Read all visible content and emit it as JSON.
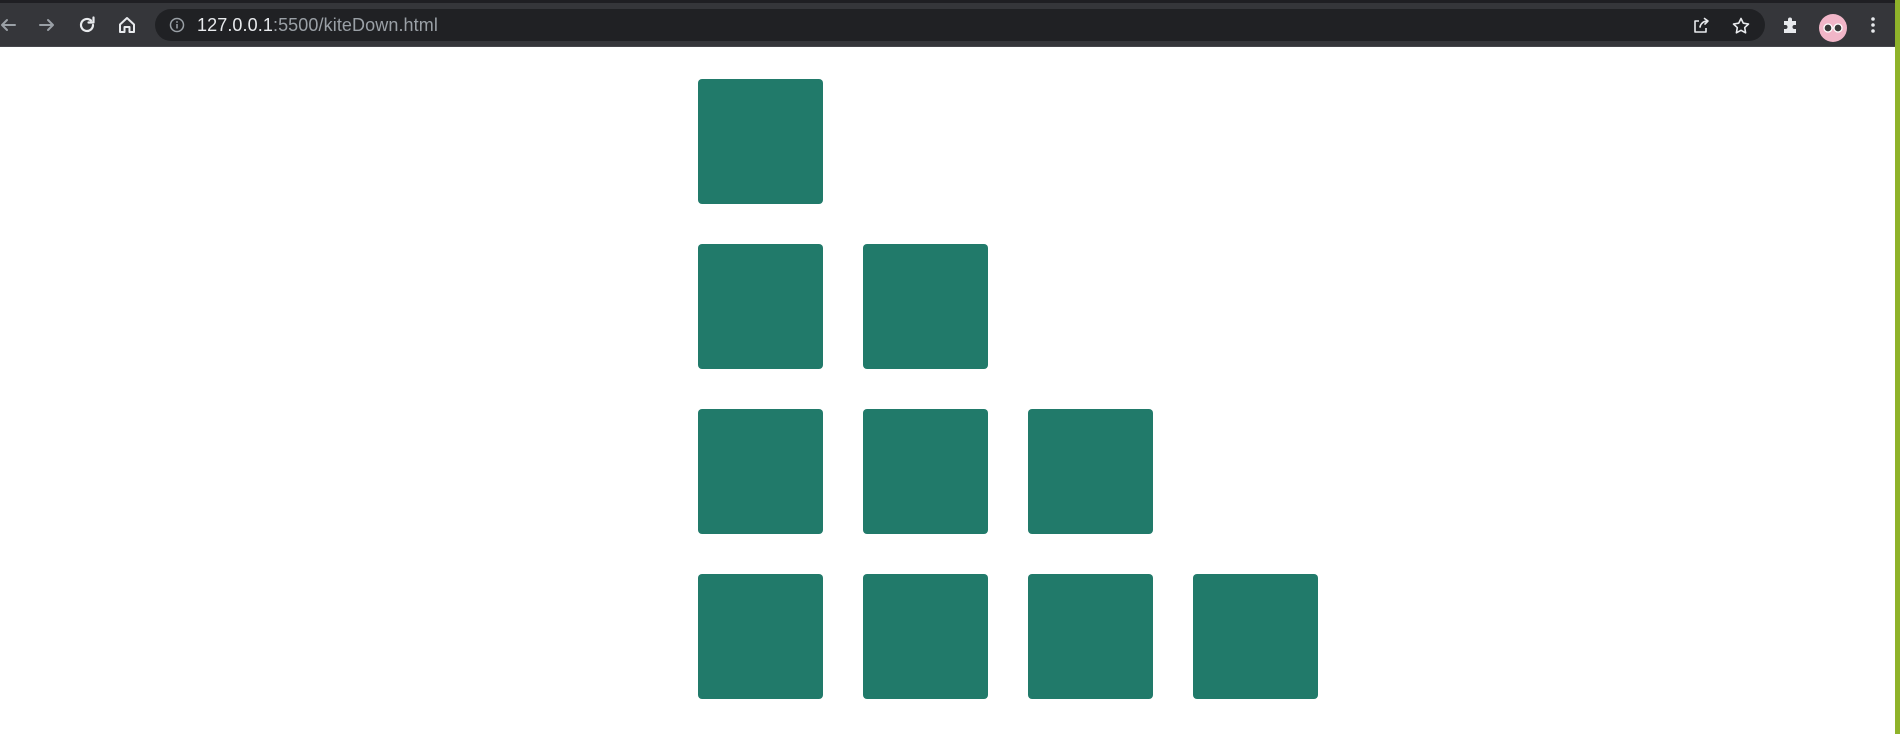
{
  "browser": {
    "url_host": "127.0.0.1",
    "url_rest": ":5500/kiteDown.html",
    "icons": [
      "back-arrow-icon",
      "forward-arrow-icon",
      "reload-icon",
      "home-icon",
      "info-icon",
      "share-icon",
      "star-icon",
      "puzzle-icon",
      "avatar",
      "kebab-menu-icon"
    ]
  },
  "page": {
    "tile_color": "#217a6a",
    "rows": [
      1,
      2,
      3,
      4
    ]
  }
}
